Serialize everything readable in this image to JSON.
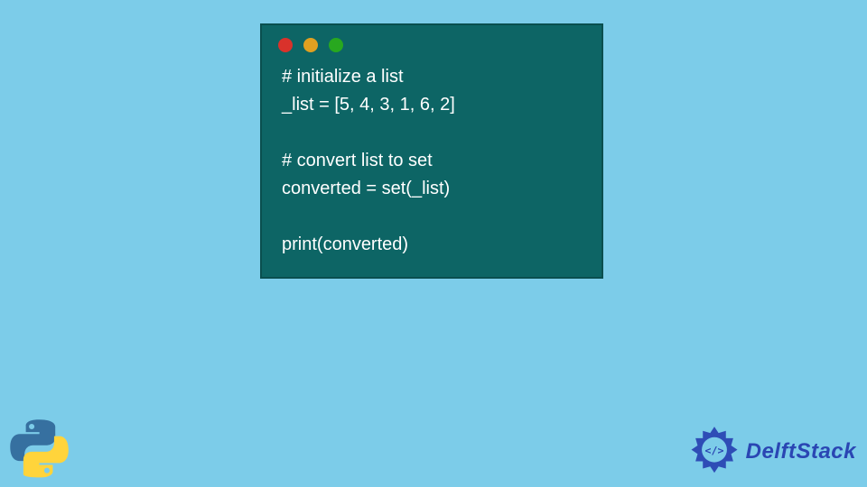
{
  "code": {
    "lines": [
      "# initialize a list",
      "_list = [5, 4, 3, 1, 6, 2]",
      "",
      "# convert list to set",
      "converted = set(_list)",
      "",
      "print(converted)"
    ]
  },
  "brand": {
    "name": "DelftStack"
  },
  "window_dots": {
    "red": "#d9322b",
    "yellow": "#e0a021",
    "green": "#28a81f"
  }
}
